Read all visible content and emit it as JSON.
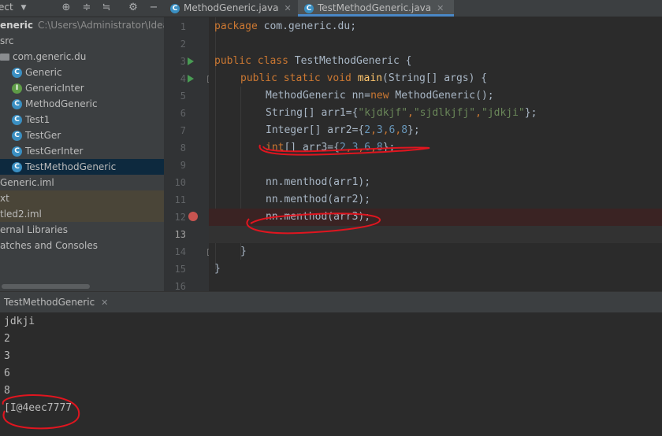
{
  "project_panel": {
    "header_label": "ect",
    "toolbar_icons": [
      "target-icon",
      "collapse-icon",
      "expand-icon",
      "gear-icon",
      "minimize-icon"
    ],
    "tree": [
      {
        "label": "eneric",
        "path": "C:\\Users\\Administrator\\IdeaPr",
        "kind": "module"
      },
      {
        "label": "src",
        "kind": "folder"
      },
      {
        "label": "com.generic.du",
        "kind": "package"
      },
      {
        "label": "Generic",
        "kind": "class"
      },
      {
        "label": "GenericInter",
        "kind": "interface"
      },
      {
        "label": "MethodGeneric",
        "kind": "class"
      },
      {
        "label": "Test1",
        "kind": "class"
      },
      {
        "label": "TestGer",
        "kind": "class"
      },
      {
        "label": "TestGerInter",
        "kind": "class"
      },
      {
        "label": "TestMethodGeneric",
        "kind": "class",
        "selected": true
      },
      {
        "label": "Generic.iml",
        "kind": "file"
      },
      {
        "label": "xt",
        "kind": "file"
      },
      {
        "label": "tled2.iml",
        "kind": "file"
      },
      {
        "label": "ernal Libraries",
        "kind": "libs"
      },
      {
        "label": "atches and Consoles",
        "kind": "scratches"
      }
    ]
  },
  "editor": {
    "tabs": [
      {
        "label": "MethodGeneric.java",
        "active": false
      },
      {
        "label": "TestMethodGeneric.java",
        "active": true
      }
    ],
    "line_numbers": [
      "1",
      "2",
      "3",
      "4",
      "5",
      "6",
      "7",
      "8",
      "9",
      "10",
      "11",
      "12",
      "13",
      "14",
      "15",
      "16"
    ],
    "lines": {
      "l1": {
        "kw": "package",
        "rest": " com.generic.du;"
      },
      "l3": {
        "kw": "public class",
        "name": " TestMethodGeneric {"
      },
      "l4": {
        "kw": "public static void",
        "fn": "main",
        "rest": "(String[] args) {"
      },
      "l5": {
        "a": "MethodGeneric nn=",
        "kw": "new",
        "b": " MethodGeneric();"
      },
      "l6": {
        "a": "String[] arr1={",
        "s1": "\"kjdkjf\"",
        "c1": ",",
        "s2": "\"sjdlkjfj\"",
        "c2": ",",
        "s3": "\"jdkji\"",
        "b": "};"
      },
      "l7": {
        "a": "Integer[] arr2={",
        "n1": "2",
        "c": ",",
        "n2": "3",
        "n3": "6",
        "n4": "8",
        "b": "};"
      },
      "l8": {
        "kw": "int",
        "a": "[] arr3={",
        "n1": "2",
        "c": ",",
        "n2": "3",
        "n3": "6",
        "n4": "8",
        "b": "};"
      },
      "l10": "nn.menthod(arr1);",
      "l11": "nn.menthod(arr2);",
      "l12": "nn.menthod(arr3);",
      "l14": "}",
      "l15": "}"
    }
  },
  "run_panel": {
    "tab_label": "TestMethodGeneric",
    "output": [
      "jdkji",
      "2",
      "3",
      "6",
      "8",
      "[I@4eec7777"
    ]
  },
  "colors": {
    "keyword": "#cc7832",
    "string": "#6a8759",
    "number": "#6897bb",
    "annotation": "#e0151f"
  }
}
